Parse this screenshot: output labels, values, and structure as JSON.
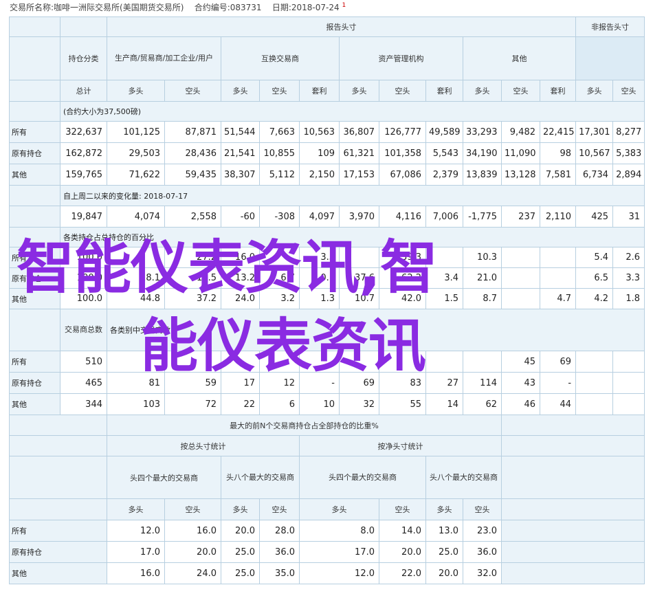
{
  "header": {
    "exchange_label": "交易所名称:咖啡一洲际交易所(美国期货交易所)",
    "code_label": "合约编号:083731",
    "date_label": "日期:2018-07-24",
    "superscript": "1"
  },
  "section1": {
    "report_group": "报告头寸",
    "nonreport_group": "非报告头寸",
    "category_header": "持仓分类",
    "groups": [
      "生产商/贸易商/加工企业/用户",
      "互换交易商",
      "资产管理机构",
      "其他"
    ],
    "total_label": "总计",
    "long": "多头",
    "short": "空头",
    "spread": "套利",
    "note_contract": "(合约大小为37,500磅)",
    "rows": [
      {
        "label": "所有",
        "values": [
          "322,637",
          "101,125",
          "87,871",
          "51,544",
          "7,663",
          "10,563",
          "36,807",
          "126,777",
          "49,589",
          "33,293",
          "9,482",
          "22,415",
          "17,301",
          "8,277"
        ]
      },
      {
        "label": "原有持仓",
        "values": [
          "162,872",
          "29,503",
          "28,436",
          "21,541",
          "10,855",
          "109",
          "61,321",
          "101,358",
          "5,543",
          "34,190",
          "11,090",
          "98",
          "10,567",
          "5,383"
        ]
      },
      {
        "label": "其他",
        "values": [
          "159,765",
          "71,622",
          "59,435",
          "38,307",
          "5,112",
          "2,150",
          "17,153",
          "67,086",
          "2,379",
          "13,839",
          "13,128",
          "7,581",
          "6,734",
          "2,894"
        ]
      }
    ],
    "note_change": "自上周二以来的变化量: 2018-07-17",
    "change_values": [
      "19,847",
      "4,074",
      "2,558",
      "-60",
      "-308",
      "4,097",
      "3,970",
      "4,116",
      "7,006",
      "-1,775",
      "237",
      "2,110",
      "425",
      "31"
    ],
    "note_pct_partial": "各类持仓占总持仓的百分比",
    "pct_rows": [
      {
        "label": "所有",
        "values": [
          "100.0",
          "",
          "27.2",
          "16.0",
          "",
          "3.3",
          "",
          "39.3",
          "",
          "10.3",
          "",
          "",
          "5.4",
          "2.6"
        ]
      },
      {
        "label": "原有持仓",
        "values": [
          "100.0",
          "18.1",
          "17.5",
          "13.2",
          "6.7",
          "0.1",
          "37.6",
          "62.2",
          "3.4",
          "21.0",
          "",
          "",
          "6.5",
          "3.3"
        ]
      },
      {
        "label": "其他",
        "values": [
          "100.0",
          "44.8",
          "37.2",
          "24.0",
          "3.2",
          "1.3",
          "10.7",
          "42.0",
          "1.5",
          "8.7",
          "",
          "4.7",
          "4.2",
          "1.8"
        ]
      }
    ],
    "trader_count_header": "交易商总数",
    "note_traders": "各类别中交易商数",
    "trader_rows": [
      {
        "label": "所有",
        "values": [
          "510",
          "",
          "",
          "",
          "",
          "",
          "",
          "",
          "",
          "",
          "45",
          "69",
          "",
          ""
        ]
      },
      {
        "label": "原有持仓",
        "values": [
          "465",
          "81",
          "59",
          "17",
          "12",
          "-",
          "69",
          "83",
          "27",
          "114",
          "43",
          "-",
          "",
          ""
        ]
      },
      {
        "label": "其他",
        "values": [
          "344",
          "103",
          "72",
          "22",
          "6",
          "10",
          "32",
          "55",
          "14",
          "62",
          "46",
          "44",
          "",
          ""
        ]
      }
    ]
  },
  "section2": {
    "title": "最大的前N个交易商持仓占全部持仓的比重%",
    "gross_label": "按总头寸统计",
    "net_label": "按净头寸统计",
    "top4": "头四个最大的交易商",
    "top8": "头八个最大的交易商",
    "long": "多头",
    "short": "空头",
    "rows": [
      {
        "label": "所有",
        "values": [
          "12.0",
          "16.0",
          "20.0",
          "28.0",
          "8.0",
          "14.0",
          "13.0",
          "23.0"
        ]
      },
      {
        "label": "原有持仓",
        "values": [
          "17.0",
          "20.0",
          "25.0",
          "36.0",
          "17.0",
          "20.0",
          "25.0",
          "36.0"
        ]
      },
      {
        "label": "其他",
        "values": [
          "16.0",
          "24.0",
          "25.0",
          "35.0",
          "12.0",
          "22.0",
          "20.0",
          "32.0"
        ]
      }
    ]
  },
  "watermark": {
    "line1": "智能仪表资讯,智",
    "line2": "能仪表资讯",
    "color": "#8a2be2"
  }
}
